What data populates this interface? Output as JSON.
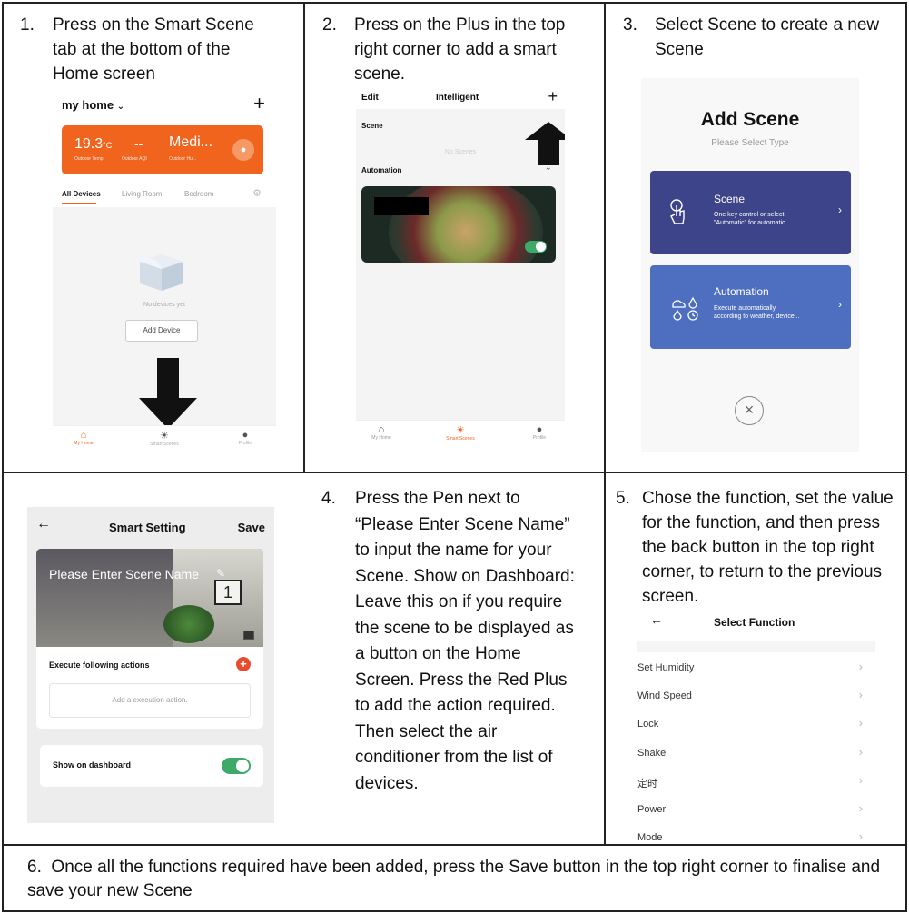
{
  "steps": {
    "s1": {
      "num": "1.",
      "text": "Press on the Smart Scene tab at the bottom of the Home screen"
    },
    "s2": {
      "num": "2.",
      "text": "Press on the Plus in the top right corner to add a smart scene."
    },
    "s3": {
      "num": "3.",
      "text": "Select Scene to create a new Scene"
    },
    "s4": {
      "num": "4.",
      "text": "Press the Pen next to “Please Enter Scene Name” to input the name for your Scene. Show on Dashboard: Leave this on if you require the scene to be displayed as a button on the Home Screen. Press the Red Plus to add the action required.  Then select the air conditioner from the list of devices."
    },
    "s5": {
      "num": "5.",
      "text": "Chose the function, set the value for the function, and then press the back button in the top right corner, to return to the previous screen."
    },
    "s6": {
      "num": "6.",
      "text": "Once all the functions required have been added, press the Save button in the top right corner to finalise and save your new Scene"
    }
  },
  "screen1": {
    "home_title": "my home",
    "add_icon": "plus-icon",
    "temp": "19.3",
    "temp_unit": "°C",
    "aqi": "--",
    "humidity": "Medi...",
    "temp_caption": "Outdoor Temp",
    "aqi_caption": "Outdoor AQI",
    "hum_caption": "Outdoor Hu...",
    "tabs": [
      "All Devices",
      "Living Room",
      "Bedroom"
    ],
    "empty_text": "No devices yet",
    "add_device": "Add Device",
    "nav": [
      "My Home",
      "Smart Scenes",
      "Profile"
    ],
    "accent": "#f0641e"
  },
  "screen2": {
    "edit": "Edit",
    "title": "Intelligent",
    "scene_header": "Scene",
    "no_scenes": "No Scenes",
    "automation_header": "Automation",
    "nav": [
      "My Home",
      "Smart Scenes",
      "Profile"
    ]
  },
  "screen3": {
    "title": "Add Scene",
    "subtitle": "Please Select Type",
    "scene_label": "Scene",
    "scene_desc_1": "One key control or select",
    "scene_desc_2": "\"Automatic\" for automatic...",
    "auto_label": "Automation",
    "auto_desc_1": "Execute automatically",
    "auto_desc_2": "according to weather, device...",
    "scene_color": "#3d4489",
    "auto_color": "#4e6fc0"
  },
  "screen4": {
    "title": "Smart Setting",
    "save": "Save",
    "name_placeholder": "Please Enter Scene Name",
    "execute_label": "Execute following actions",
    "add_action": "Add a execution action.",
    "dashboard_label": "Show on dashboard",
    "toggle_color": "#3daa6a"
  },
  "screen5": {
    "title": "Select Function",
    "functions": [
      "Set Humidity",
      "Wind Speed",
      "Lock",
      "Shake",
      "定时",
      "Power",
      "Mode"
    ]
  }
}
